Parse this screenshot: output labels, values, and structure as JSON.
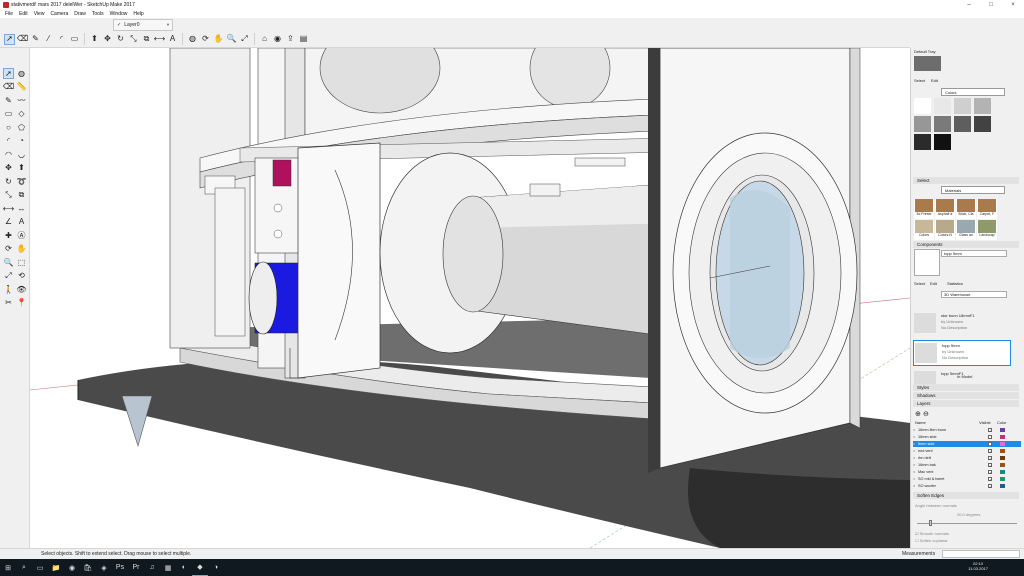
{
  "window": {
    "title": "stativmerdi! mars 2017 delelWer - SketchUp Make 2017",
    "min": "–",
    "max": "□",
    "close": "×"
  },
  "menu": [
    "File",
    "Edit",
    "View",
    "Camera",
    "Draw",
    "Tools",
    "Window",
    "Help"
  ],
  "layer_toolbar": {
    "check": "✓",
    "layer": "Layer0"
  },
  "toolbar_icons": [
    "select-icon",
    "eraser-icon",
    "pencil-icon",
    "line-icon",
    "arc-icon",
    "shape-icon",
    "pushpull-icon",
    "move-icon",
    "rotate-icon",
    "scale-icon",
    "offset-icon",
    "tape-icon",
    "text-icon",
    "paint-icon",
    "orbit-icon",
    "pan-icon",
    "zoom-icon",
    "zoom-extents-icon",
    "warehouse-icon",
    "extension-icon",
    "share-icon",
    "layout-icon"
  ],
  "toolbar_glyphs": [
    "➚",
    "⌫",
    "✎",
    "⁄",
    "◜",
    "▭",
    "⬆",
    "✥",
    "↻",
    "⤡",
    "⧉",
    "⟷",
    "A",
    "◍",
    "⟳",
    "✋",
    "🔍",
    "⤢",
    "⌂",
    "◉",
    "⇪",
    "▤"
  ],
  "left_tools": [
    "select-icon",
    "paint-icon",
    "eraser-icon",
    "ruler-icon",
    "pencil-icon",
    "freehand-icon",
    "rectangle-icon",
    "rotated-rect-icon",
    "circle-icon",
    "polygon-icon",
    "arc-icon",
    "pie-icon",
    "arc2-icon",
    "arc3-icon",
    "move-icon",
    "pushpull-icon",
    "rotate-icon",
    "followme-icon",
    "scale-icon",
    "offset-icon",
    "tape-icon",
    "dimension-icon",
    "protractor-icon",
    "text-icon",
    "axes-icon",
    "3dtext-icon",
    "orbit-icon",
    "pan-icon",
    "zoom-icon",
    "zoomwindow-icon",
    "zoomextents-icon",
    "previous-icon",
    "walk-icon",
    "lookaround-icon",
    "section-icon",
    "position-camera-icon"
  ],
  "left_glyphs": [
    "➚",
    "◍",
    "⌫",
    "📏",
    "✎",
    "〰",
    "▭",
    "◇",
    "○",
    "⬠",
    "◜",
    "◔",
    "◠",
    "◡",
    "✥",
    "⬆",
    "↻",
    "➰",
    "⤡",
    "⧉",
    "⟷",
    "↔",
    "∠",
    "A",
    "✚",
    "Ⓐ",
    "⟳",
    "✋",
    "🔍",
    "⬚",
    "⤢",
    "⟲",
    "🚶",
    "👁",
    "✂",
    "📍"
  ],
  "tray": {
    "title": "Default Tray",
    "colors_panel": {
      "tabs": [
        "Select",
        "Edit"
      ],
      "library": "Colors",
      "swatches": [
        "#ffffff",
        "#e8e8e8",
        "#cfcfcf",
        "#b3b3b3",
        "#979797",
        "#7a7a7a",
        "#5e5e5e",
        "#424242",
        "#2b2b2b",
        "#111111"
      ]
    },
    "materials_panel": {
      "header": "Select",
      "library": "Materials",
      "items": [
        "3d Printer",
        "Asphalt a",
        "Brick, Cla",
        "Carpet, F",
        "Colors",
        "Colors-N",
        "Glass an",
        "Landscap"
      ]
    },
    "components": {
      "header": "Components",
      "selected": "topp 5mm",
      "tabs": [
        "Select",
        "Edit",
        "Statistics"
      ],
      "search": "3D Warehouse",
      "results": [
        {
          "name": "stor bunn 18mmF1",
          "by": "by Unknown",
          "desc": "No Description"
        },
        {
          "name": "topp 5mm",
          "by": "by Unknown",
          "desc": "No Description"
        },
        {
          "name": "topp 5mmF1",
          "by": "",
          "desc": ""
        }
      ],
      "in_model": "In Model"
    },
    "collapsed": [
      "Styles",
      "Shadows",
      "Layers"
    ],
    "layers": {
      "headers": [
        "Name",
        "Visible",
        "Color"
      ],
      "rows": [
        {
          "name": "16mm liten bunn",
          "visible": true,
          "color": "#6a3fa0",
          "active": false
        },
        {
          "name": "16mm side",
          "visible": false,
          "color": "#b7357f",
          "active": false
        },
        {
          "name": "5mm side",
          "visible": true,
          "color": "#e76ad9",
          "active": true
        },
        {
          "name": "end vent",
          "visible": true,
          "color": "#9e5316",
          "active": false
        },
        {
          "name": "rbn dett",
          "visible": true,
          "color": "#6e3a0c",
          "active": false
        },
        {
          "name": "16mm bak",
          "visible": true,
          "color": "#8a5b1e",
          "active": false
        },
        {
          "name": "Mac vent",
          "visible": true,
          "color": "#1a8b7a",
          "active": false
        },
        {
          "name": "SO mid & tweet",
          "visible": true,
          "color": "#1d9a6f",
          "active": false
        },
        {
          "name": "SO woofer",
          "visible": true,
          "color": "#1c5e93",
          "active": false
        }
      ]
    },
    "soften": {
      "header": "Soften Edges",
      "angle_label": "Angle between normals",
      "angle_value": "20.0 degrees",
      "opt1": "Smooth normals",
      "opt2": "Soften coplanar"
    }
  },
  "status": {
    "text": "Select objects. Shift to extend select. Drag mouse to select multiple.",
    "measurements_label": "Measurements"
  },
  "taskbar": {
    "icons": [
      "windows-icon",
      "search-icon",
      "taskview-icon",
      "explorer-icon",
      "chrome-icon",
      "store-icon",
      "app-icon",
      "photoshop-icon",
      "premiere-icon",
      "spotify-icon",
      "calculator-icon",
      "app2-icon",
      "sketchup-icon",
      "app3-icon"
    ],
    "glyphs": [
      "⊞",
      "⌕",
      "▭",
      "📁",
      "◉",
      "🛍",
      "◈",
      "Ps",
      "Pr",
      "♫",
      "▦",
      "◐",
      "◆",
      "◑"
    ],
    "time": "02:10",
    "date": "11.03.2017"
  }
}
